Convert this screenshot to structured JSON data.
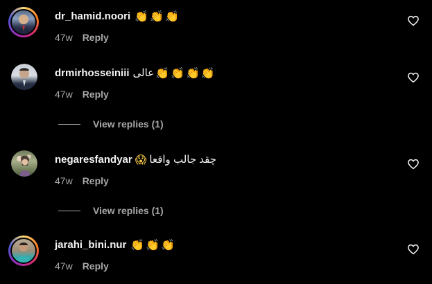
{
  "comments": [
    {
      "username": "dr_hamid.noori",
      "text": "",
      "emoji": "👏👏👏",
      "time": "47w",
      "reply_label": "Reply",
      "avatar_story_ring": true
    },
    {
      "username": "drmirhosseiniii",
      "text": "عالی",
      "emoji": "👏👏👏👏",
      "time": "47w",
      "reply_label": "Reply",
      "avatar_story_ring": false,
      "view_replies": "View replies (1)"
    },
    {
      "username": "negaresfandyar",
      "text": "چقد جالب واقعا",
      "emoji": "😱",
      "time": "47w",
      "reply_label": "Reply",
      "avatar_story_ring": false,
      "view_replies": "View replies (1)"
    },
    {
      "username": "jarahi_bini.nur",
      "text": "",
      "emoji": "👏👏👏",
      "time": "47w",
      "reply_label": "Reply",
      "avatar_story_ring": true
    }
  ],
  "icons": {
    "like": "heart-outline-icon"
  },
  "colors": {
    "background": "#000000",
    "primary_text": "#f5f5f5",
    "secondary_text": "#a8a8a8"
  }
}
